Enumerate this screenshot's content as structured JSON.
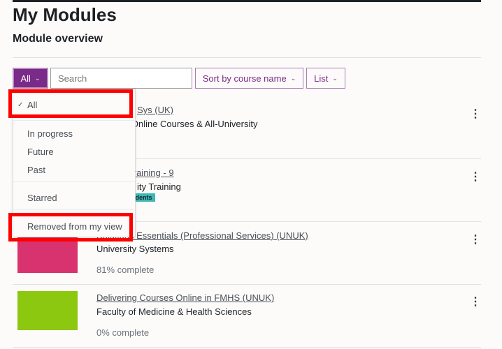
{
  "page": {
    "title": "My Modules",
    "subtitle": "Module overview"
  },
  "controls": {
    "filter_label": "All",
    "search_placeholder": "Search",
    "sort_label": "Sort by course name",
    "view_label": "List"
  },
  "filter_menu": {
    "items": [
      {
        "label": "All",
        "selected": true
      },
      {
        "label": "In progress"
      },
      {
        "label": "Future"
      },
      {
        "label": "Past"
      },
      {
        "label": "Starred"
      },
      {
        "label": "Removed from my view"
      }
    ]
  },
  "courses": [
    {
      "title": "Sys (UK)",
      "category": "m Open Online Courses & All-University",
      "progress": "",
      "thumb_color": "#4a90c0"
    },
    {
      "title": "Central Training - 9",
      "category": "ity Training",
      "badge": "n students",
      "progress": "",
      "thumb_color": "#e08030"
    },
    {
      "title": "Solutions Essentials (Professional Services) (UNUK)",
      "category": "University Systems",
      "progress": "81% complete",
      "thumb_color": "#d8336f"
    },
    {
      "title": "Delivering Courses Online in FMHS (UNUK)",
      "category": "Faculty of Medicine & Health Sciences",
      "progress": "0% complete",
      "thumb_color": "#8cc810"
    }
  ],
  "colors": {
    "accent": "#7a2a89",
    "highlight": "#ff0000",
    "badge": "#3bb7b4"
  }
}
